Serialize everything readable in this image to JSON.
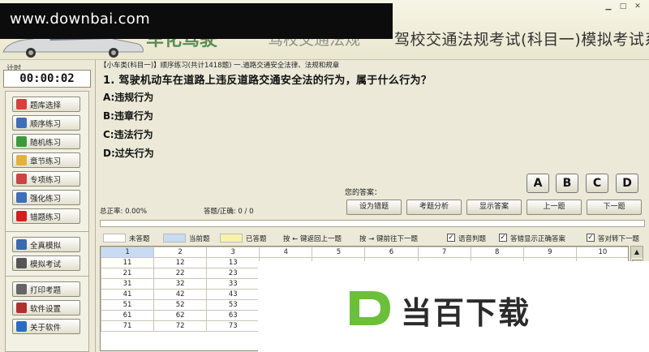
{
  "watermark": {
    "text": "www.downbai.com"
  },
  "app": {
    "title": "驾校交通法规考试(科目一)模拟考试系统",
    "title_partial_left": "车化驾驶",
    "title_partial_mid": "驾校交通法规"
  },
  "timer": {
    "label": "计时",
    "value": "00:00:02"
  },
  "menu": {
    "group1": [
      {
        "label": "题库选择",
        "icon": "database-icon",
        "color": "#D8403A"
      },
      {
        "label": "顺序练习",
        "icon": "document-icon",
        "color": "#3E6FB8"
      },
      {
        "label": "随机练习",
        "icon": "refresh-icon",
        "color": "#3A9A3A"
      },
      {
        "label": "章节练习",
        "icon": "folder-icon",
        "color": "#E3B23C"
      },
      {
        "label": "专项练习",
        "icon": "checklist-icon",
        "color": "#C44"
      },
      {
        "label": "强化练习",
        "icon": "chart-icon",
        "color": "#3E6FB8"
      },
      {
        "label": "错题练习",
        "icon": "flag-icon",
        "color": "#D02020"
      }
    ],
    "group2": [
      {
        "label": "全真模拟",
        "icon": "monitor-icon",
        "color": "#3A6AB0"
      },
      {
        "label": "模拟考试",
        "icon": "exam-icon",
        "color": "#555"
      }
    ],
    "group3": [
      {
        "label": "打印考题",
        "icon": "printer-icon",
        "color": "#666"
      },
      {
        "label": "软件设置",
        "icon": "wrench-icon",
        "color": "#B03030"
      },
      {
        "label": "关于软件",
        "icon": "info-icon",
        "color": "#2A6CC4"
      }
    ]
  },
  "breadcrumb": "【小车类(科目一)】顺序练习(共计1418题) 一.道路交通安全法律、法规和规章",
  "question": {
    "text": "1. 驾驶机动车在道路上违反道路交通安全法的行为，属于什么行为？",
    "options": [
      "A:违规行为",
      "B:违章行为",
      "C:违法行为",
      "D:过失行为"
    ]
  },
  "answer": {
    "label": "您的答案：",
    "buttons": [
      "A",
      "B",
      "C",
      "D"
    ]
  },
  "stats": {
    "accuracy": "总正率: 0.00%",
    "answered": "答题/正确: 0 / 0"
  },
  "actions": [
    "设为错题",
    "考题分析",
    "显示答案",
    "上一题",
    "下一题"
  ],
  "progress": {
    "fraction": 0.0
  },
  "legend": {
    "unanswered": "未答题",
    "current": "当前题",
    "answered": "已答题",
    "prev_hint": "按 ← 键返回上一题",
    "next_hint": "按 → 键前往下一题",
    "check1": "语音判题",
    "check2": "答错显示正确答案",
    "check3": "答对转下一题",
    "colors": {
      "unanswered": "#FFFFFF",
      "current": "#C9DBF2",
      "answered": "#F7F2A8"
    }
  },
  "grid": {
    "rows": [
      [
        "1",
        "2",
        "3",
        "4",
        "5",
        "6",
        "7",
        "8",
        "9",
        "10"
      ],
      [
        "11",
        "12",
        "13",
        "",
        "",
        "",
        "",
        "",
        "",
        ""
      ],
      [
        "21",
        "22",
        "23",
        "",
        "",
        "",
        "",
        "",
        "",
        ""
      ],
      [
        "31",
        "32",
        "33",
        "",
        "",
        "",
        "",
        "",
        "",
        ""
      ],
      [
        "41",
        "42",
        "43",
        "",
        "",
        "",
        "",
        "",
        "",
        ""
      ],
      [
        "51",
        "52",
        "53",
        "",
        "",
        "",
        "",
        "",
        "",
        ""
      ],
      [
        "61",
        "62",
        "63",
        "",
        "",
        "",
        "",
        "",
        "",
        ""
      ],
      [
        "71",
        "72",
        "73",
        "",
        "",
        "",
        "",
        "",
        "",
        ""
      ]
    ]
  },
  "logo": {
    "text": "当百下载",
    "mark": "D"
  }
}
